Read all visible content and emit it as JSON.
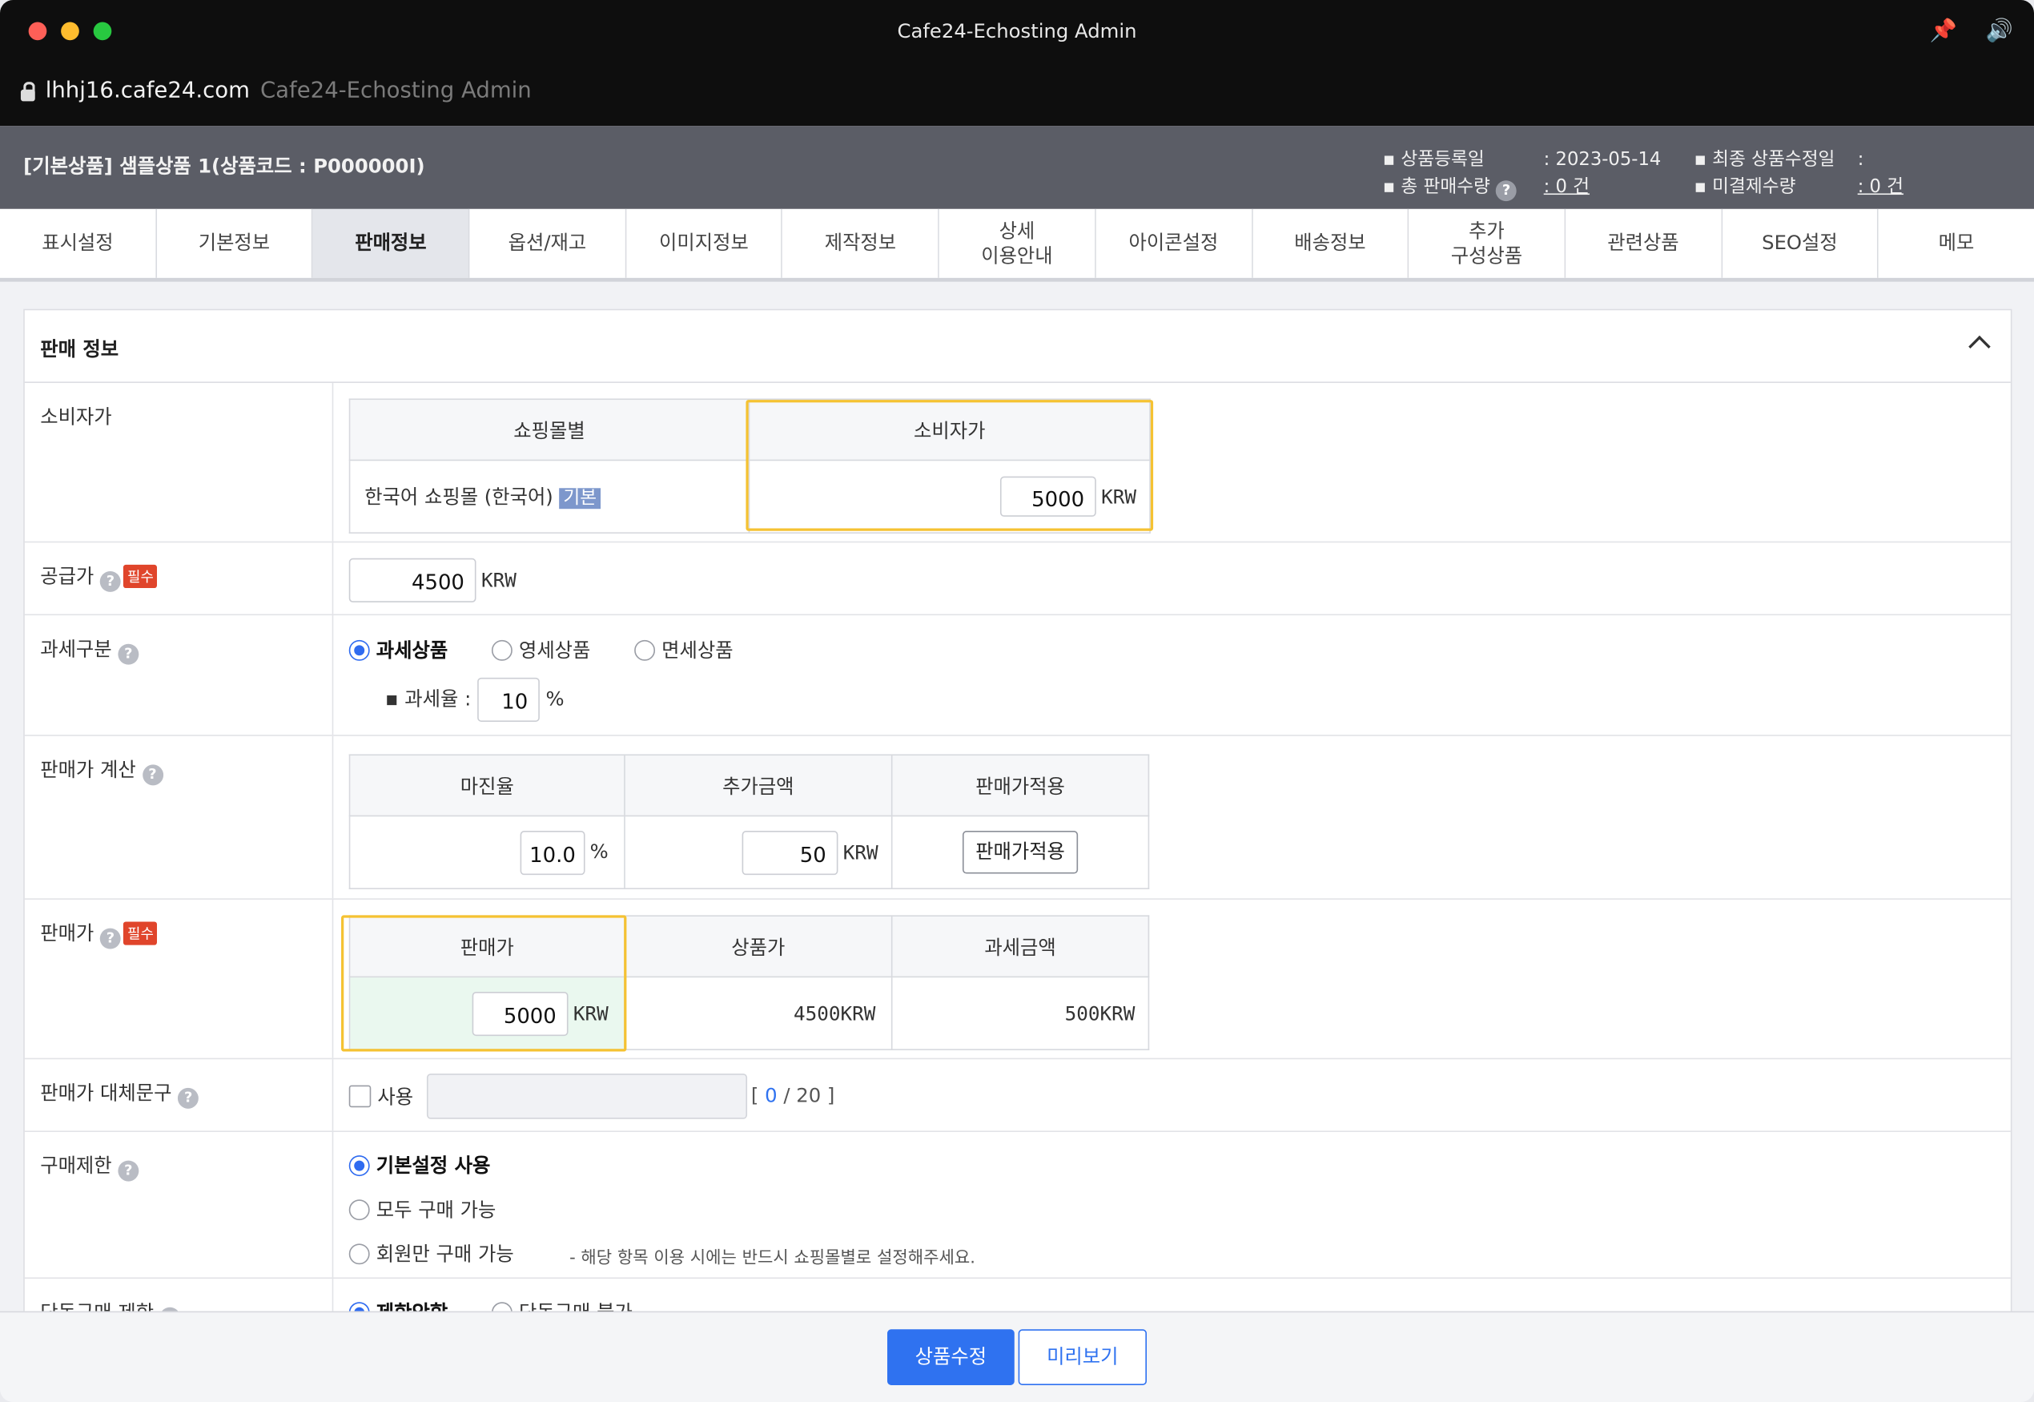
{
  "window": {
    "title": "Cafe24-Echosting Admin",
    "url_host": "lhhj16.cafe24.com",
    "url_title": "Cafe24-Echosting Admin"
  },
  "header": {
    "product_title": "[기본상품] 샘플상품 1(상품코드 : P000000I)",
    "reg_date_label": "▪ 상품등록일",
    "reg_date_value": ": 2023-05-14",
    "total_sales_label": "▪ 총 판매수량",
    "total_sales_value": ": 0 건",
    "last_modified_label": "▪ 최종 상품수정일",
    "last_modified_value": ":",
    "unpaid_label": "▪ 미결제수량",
    "unpaid_value": ": 0 건"
  },
  "tabs": [
    {
      "label": "표시설정"
    },
    {
      "label": "기본정보"
    },
    {
      "label": "판매정보"
    },
    {
      "label": "옵션/재고"
    },
    {
      "label": "이미지정보"
    },
    {
      "label": "제작정보"
    },
    {
      "label": "상세\n이용안내"
    },
    {
      "label": "아이콘설정"
    },
    {
      "label": "배송정보"
    },
    {
      "label": "추가\n구성상품"
    },
    {
      "label": "관련상품"
    },
    {
      "label": "SEO설정"
    },
    {
      "label": "메모"
    }
  ],
  "section": {
    "title": "판매 정보"
  },
  "consumer_price": {
    "label": "소비자가",
    "col_mall": "쇼핑몰별",
    "col_price": "소비자가",
    "mall_name": "한국어 쇼핑몰 (한국어)",
    "mall_badge": "기본",
    "value": "5000",
    "currency": "KRW"
  },
  "supply_price": {
    "label": "공급가",
    "required": "필수",
    "value": "4500",
    "currency": "KRW"
  },
  "tax": {
    "label": "과세구분",
    "options": [
      "과세상품",
      "영세상품",
      "면세상품"
    ],
    "rate_label": "▪  과세율 :",
    "rate_value": "10",
    "rate_unit": "%"
  },
  "price_calc": {
    "label": "판매가 계산",
    "col_margin": "마진율",
    "col_extra": "추가금액",
    "col_apply": "판매가적용",
    "margin_value": "10.0",
    "margin_unit": "%",
    "extra_value": "50",
    "extra_unit": "KRW",
    "apply_button": "판매가적용"
  },
  "sale_price": {
    "label": "판매가",
    "required": "필수",
    "col_sale": "판매가",
    "col_product": "상품가",
    "col_tax": "과세금액",
    "value": "5000",
    "currency": "KRW",
    "product_price": "4500KRW",
    "tax_amount": "500KRW"
  },
  "alt_text": {
    "label": "판매가 대체문구",
    "checkbox_label": "사용",
    "counter_open": "[",
    "count": "0",
    "counter_rest": "/ 20 ]"
  },
  "purchase_limit": {
    "label": "구매제한",
    "options": [
      "기본설정 사용",
      "모두 구매 가능",
      "회원만 구매 가능"
    ],
    "note": "- 해당 항목 이용 시에는 반드시 쇼핑몰별로 설정해주세요."
  },
  "solo_purchase": {
    "label": "단독구매 제한",
    "options": [
      "제한안함",
      "단독구매 불가"
    ]
  },
  "actions": {
    "submit": "상품수정",
    "preview": "미리보기"
  },
  "colors": {
    "accent": "#2f72f0",
    "highlight": "#f5c232",
    "required": "#e0452b"
  }
}
